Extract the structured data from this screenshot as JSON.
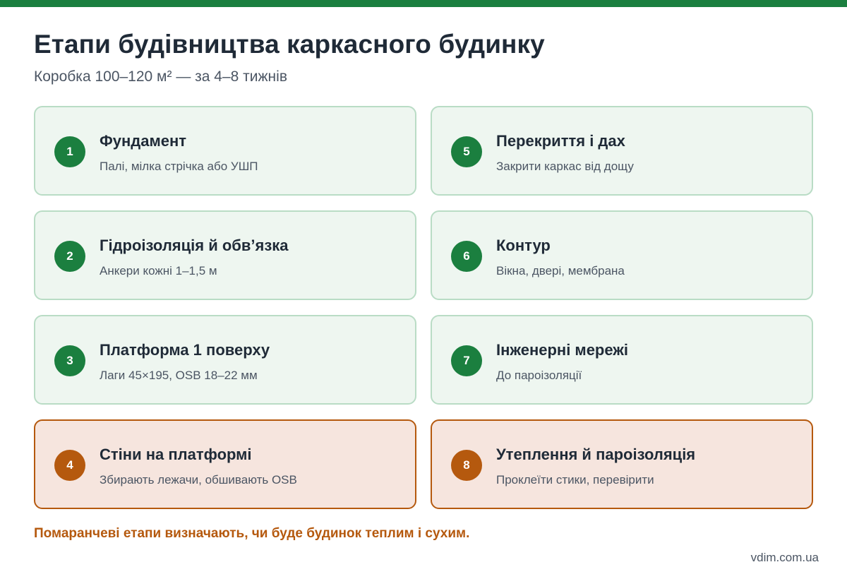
{
  "header": {
    "title": "Етапи будівництва каркасного будинку",
    "subtitle": "Коробка 100–120 м² — за 4–8 тижнів"
  },
  "colors": {
    "brand_green": "#1b7f3f",
    "accent_orange": "#b5590e",
    "card_green_bg": "#eef6f0",
    "card_orange_bg": "#f6e5de"
  },
  "stages": [
    {
      "number": "1",
      "title": "Фундамент",
      "description": "Палі, мілка стрічка або УШП",
      "highlighted": false
    },
    {
      "number": "2",
      "title": "Гідроізоляція й обв’язка",
      "description": "Анкери кожні 1–1,5 м",
      "highlighted": false
    },
    {
      "number": "3",
      "title": "Платформа 1 поверху",
      "description": "Лаги 45×195, OSB 18–22 мм",
      "highlighted": false
    },
    {
      "number": "4",
      "title": "Стіни на платформі",
      "description": "Збирають лежачи, обшивають OSB",
      "highlighted": true
    },
    {
      "number": "5",
      "title": "Перекриття і дах",
      "description": "Закрити каркас від дощу",
      "highlighted": false
    },
    {
      "number": "6",
      "title": "Контур",
      "description": "Вікна, двері, мембрана",
      "highlighted": false
    },
    {
      "number": "7",
      "title": "Інженерні мережі",
      "description": "До пароізоляції",
      "highlighted": false
    },
    {
      "number": "8",
      "title": "Утеплення й пароізоляція",
      "description": "Проклеїти стики, перевірити",
      "highlighted": true
    }
  ],
  "note": "Помаранчеві етапи визначають, чи буде будинок теплим і сухим.",
  "footer": {
    "source": "vdim.com.ua"
  }
}
